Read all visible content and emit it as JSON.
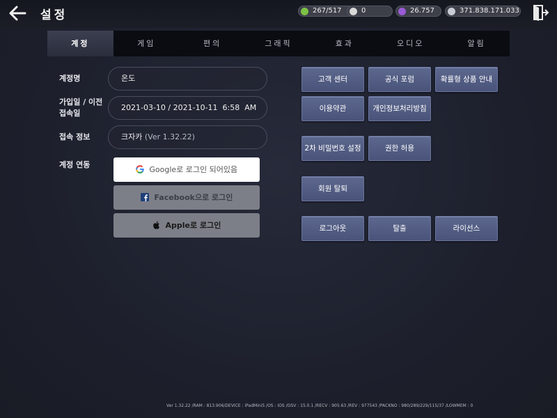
{
  "header": {
    "title": "설정",
    "currencies": [
      {
        "icon": "green-orb-icon",
        "value": "267/517",
        "color": "#7cc245"
      },
      {
        "icon": "pearl-icon",
        "value": "0",
        "color": "#d8d8d8"
      },
      {
        "icon": "purple-gem-icon",
        "value": "26.757",
        "color": "#9a5bd6"
      },
      {
        "icon": "silver-coin-icon",
        "value": "371.838.171.033",
        "color": "#c8ccd4"
      }
    ]
  },
  "tabs": [
    {
      "label": "계정",
      "active": true
    },
    {
      "label": "게임",
      "active": false
    },
    {
      "label": "편의",
      "active": false
    },
    {
      "label": "그래픽",
      "active": false
    },
    {
      "label": "효과",
      "active": false
    },
    {
      "label": "오디오",
      "active": false
    },
    {
      "label": "알림",
      "active": false
    }
  ],
  "account": {
    "name_label": "계정명",
    "name_value": "온도",
    "join_label_1": "가입일 / 이전",
    "join_label_2": "접속일",
    "join_value": "2021-03-10 / 2021-10-11  6:58  AM",
    "server_label": "접속 정보",
    "server_name": "크자카",
    "server_version": "(Ver 1.32.22)",
    "link_label": "계정 연동",
    "google_label": "Google로 로그인 되어있음",
    "facebook_label": "Facebook으로 로그인",
    "apple_label": "Apple로 로그인"
  },
  "buttons": {
    "customer_center": "고객 센터",
    "official_forum": "공식 포럼",
    "probability_info": "확률형 상품 안내",
    "terms": "이용약관",
    "privacy": "개인정보처리방침",
    "second_password": "2차 비밀번호 설정",
    "permissions": "권한 허용",
    "withdraw": "회원 탈퇴",
    "logout": "로그아웃",
    "exit": "탈출",
    "license": "라이선스"
  },
  "footer": {
    "debug_info": "Ver 1.32.22 /RAM : 813.906/DEVICE : iPadMini5 /OS : IOS /OSV : 15.0.1 /RECV : 905.63 /REV : 977543 /PACKNO : 980/289/229/115/37 /LOWMEM : 0"
  }
}
